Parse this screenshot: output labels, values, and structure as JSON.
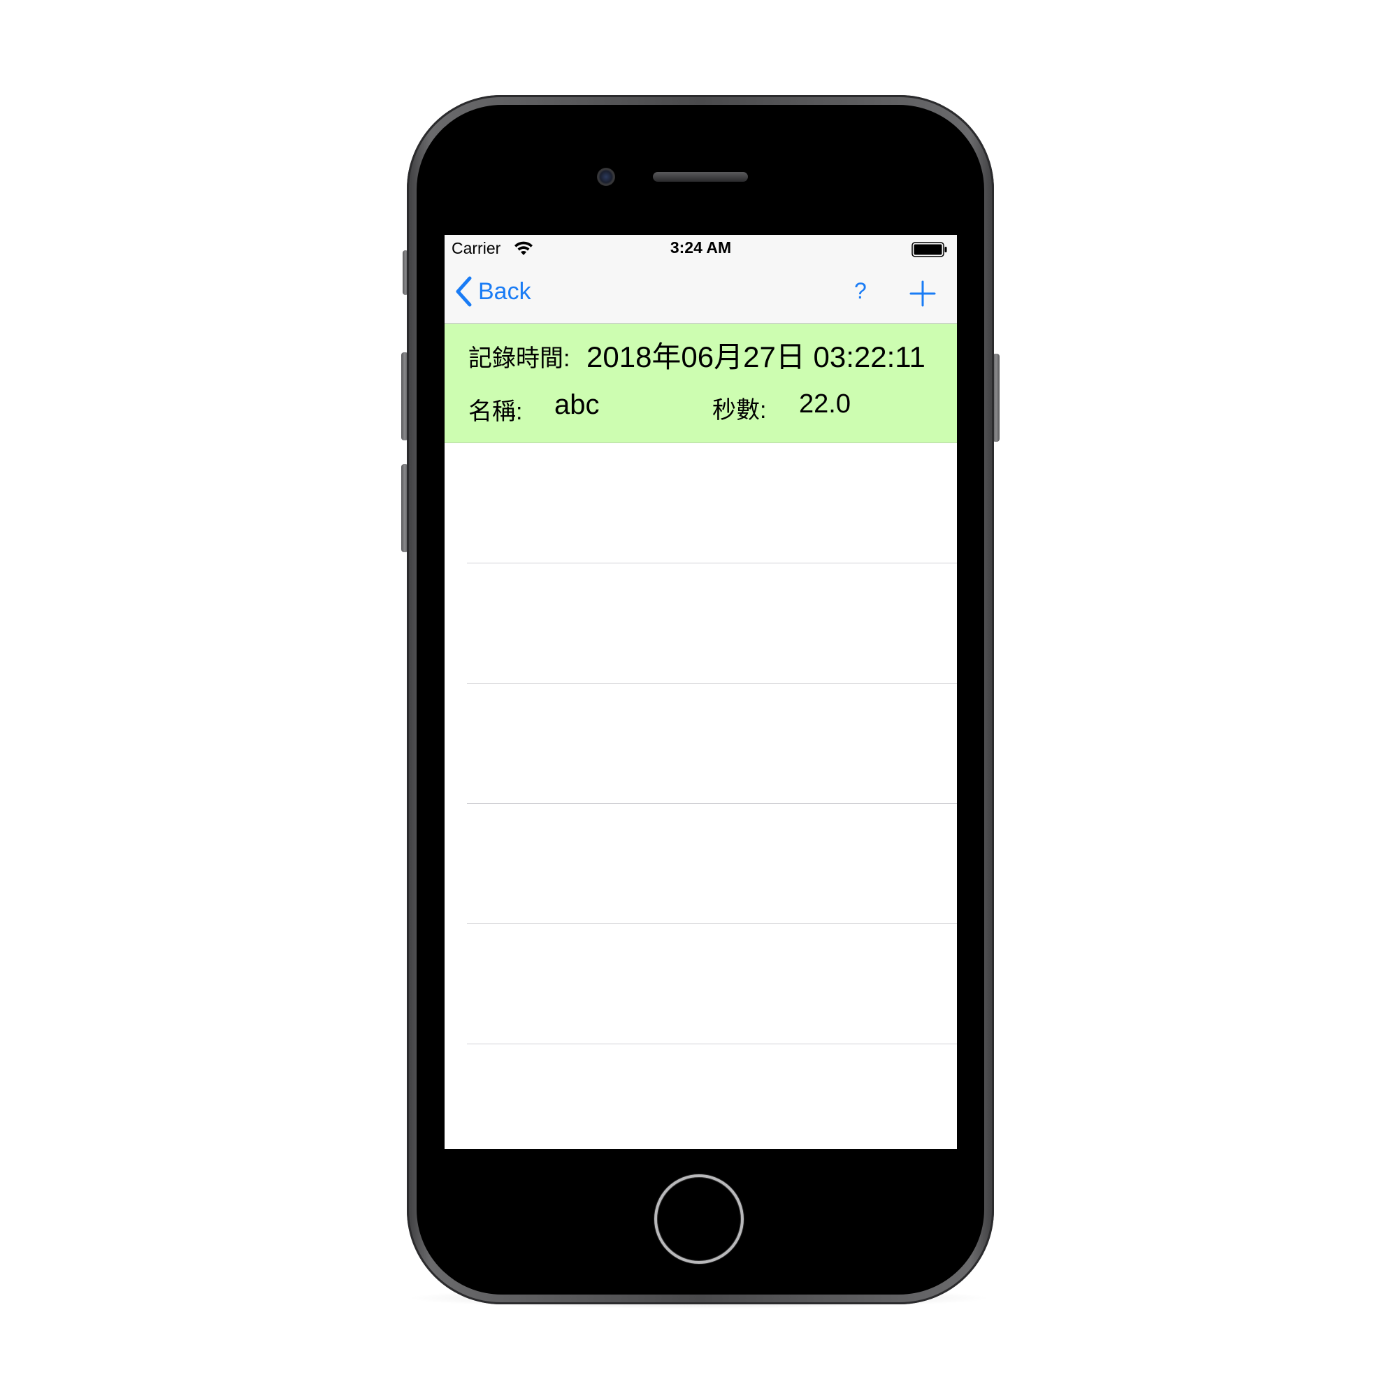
{
  "status_bar": {
    "carrier": "Carrier",
    "time": "3:24 AM"
  },
  "nav_bar": {
    "back_label": "Back",
    "help_label": "?",
    "tint_color": "#1a7cf5"
  },
  "record": {
    "time_label": "記錄時間:",
    "time_value": "2018年06月27日 03:22:11",
    "name_label": "名稱:",
    "name_value": "abc",
    "seconds_label": "秒數:",
    "seconds_value": "22.0",
    "background_color": "#cdfdb1"
  },
  "icons": {
    "wifi": "wifi-icon",
    "battery": "battery-icon",
    "back": "chevron-left-icon",
    "add": "plus-icon"
  }
}
